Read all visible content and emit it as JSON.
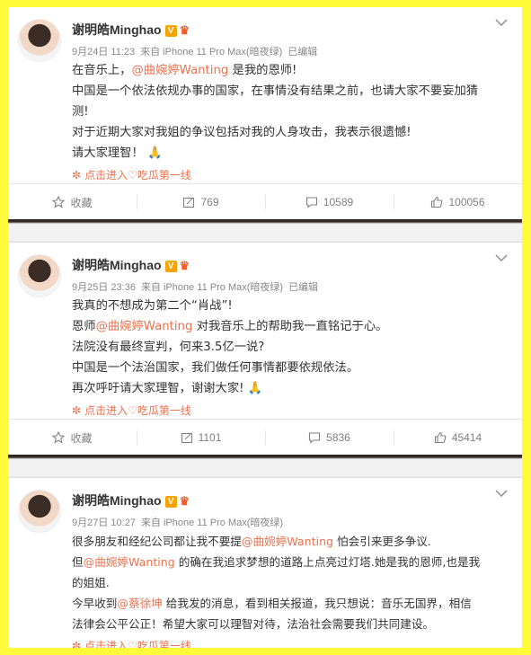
{
  "user": {
    "name": "谢明皓Minghao"
  },
  "posts": [
    {
      "meta": {
        "time": "9月24日 11:23",
        "source": "来自 iPhone 11 Pro Max(暗夜绿)",
        "edited": "已编辑"
      },
      "lines": [
        {
          "pre": "在音乐上，",
          "mention": "@曲婉婷Wanting",
          "post": " 是我的恩师!"
        },
        {
          "pre": "中国是一个依法依规办事的国家，在事情没有结果之前，也请大家不要妄加猜"
        },
        {
          "pre": "测!"
        },
        {
          "pre": "对于近期大家对我姐的争议包括对我的人身攻击，我表示很遗憾!"
        },
        {
          "pre": "请大家理智！",
          "emoji": "🙏"
        }
      ],
      "topic": "点击进入♡吃瓜第一线",
      "actions": {
        "collect": "收藏",
        "repost": "769",
        "comment": "10589",
        "like": "100056"
      }
    },
    {
      "meta": {
        "time": "9月25日 23:36",
        "source": "来自 iPhone 11 Pro Max(暗夜绿)",
        "edited": "已编辑"
      },
      "lines": [
        {
          "pre": "我真的不想成为第二个“肖战”!"
        },
        {
          "pre": "恩师",
          "mention": "@曲婉婷Wanting",
          "post": " 对我音乐上的帮助我一直铭记于心。"
        },
        {
          "pre": "法院没有最终宣判，何来3.5亿一说?"
        },
        {
          "pre": "中国是一个法治国家，我们做任何事情都要依规依法。"
        },
        {
          "pre": "再次呼吁请大家理智，谢谢大家!",
          "emoji": "🙏"
        }
      ],
      "topic": "点击进入♡吃瓜第一线",
      "actions": {
        "collect": "收藏",
        "repost": "1101",
        "comment": "5836",
        "like": "45414"
      }
    },
    {
      "meta": {
        "time": "9月27日 10:27",
        "source": "来自 iPhone 11 Pro Max(暗夜绿)",
        "edited": ""
      },
      "lines": [
        {
          "pre": "很多朋友和经纪公司都让我不要提",
          "mention": "@曲婉婷Wanting",
          "post": " 怕会引来更多争议."
        },
        {
          "pre": "但",
          "mention": "@曲婉婷Wanting",
          "post": " 的确在我追求梦想的道路上点亮过灯塔.她是我的恩师,也是我"
        },
        {
          "pre": "的姐姐."
        },
        {
          "pre": "今早收到",
          "mention": "@蔡徐坤",
          "post": " 给我发的消息，看到相关报道，我只想说：音乐无国界，相信"
        },
        {
          "pre": "法律会公平公正！希望大家可以理智对待，法治社会需要我们共同建设。"
        }
      ],
      "topic": "点击进入♡吃瓜第一线",
      "actions": null
    }
  ]
}
